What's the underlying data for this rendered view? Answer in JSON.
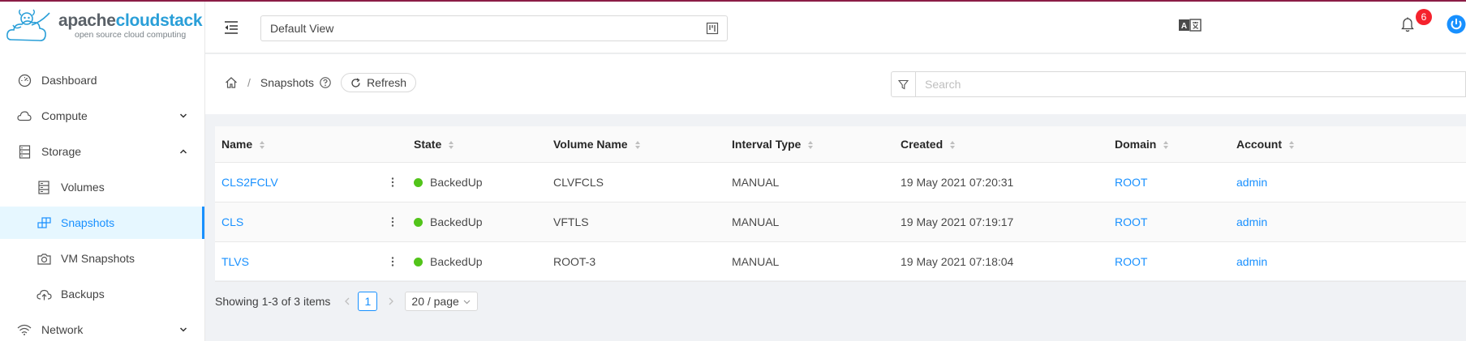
{
  "app": {
    "logo_main_a": "apache",
    "logo_main_b": "cloudstack",
    "logo_sub": "open source cloud computing"
  },
  "header": {
    "project_view": "Default View",
    "notification_count": "6"
  },
  "sidebar": {
    "items": [
      {
        "label": "Dashboard",
        "icon": "dashboard-icon"
      },
      {
        "label": "Compute",
        "icon": "cloud-icon"
      },
      {
        "label": "Storage",
        "icon": "database-icon"
      },
      {
        "label": "Volumes",
        "icon": "hdd-icon"
      },
      {
        "label": "Snapshots",
        "icon": "build-icon"
      },
      {
        "label": "VM Snapshots",
        "icon": "camera-icon"
      },
      {
        "label": "Backups",
        "icon": "cloud-upload-icon"
      },
      {
        "label": "Network",
        "icon": "wifi-icon"
      }
    ]
  },
  "breadcrumb": {
    "current": "Snapshots",
    "refresh_label": "Refresh"
  },
  "search": {
    "placeholder": "Search"
  },
  "table": {
    "columns": [
      "Name",
      "State",
      "Volume Name",
      "Interval Type",
      "Created",
      "Domain",
      "Account"
    ],
    "rows": [
      {
        "name": "CLS2FCLV",
        "state": "BackedUp",
        "volume": "CLVFCLS",
        "interval": "MANUAL",
        "created": "19 May 2021 07:20:31",
        "domain": "ROOT",
        "account": "admin"
      },
      {
        "name": "CLS",
        "state": "BackedUp",
        "volume": "VFTLS",
        "interval": "MANUAL",
        "created": "19 May 2021 07:19:17",
        "domain": "ROOT",
        "account": "admin"
      },
      {
        "name": "TLVS",
        "state": "BackedUp",
        "volume": "ROOT-3",
        "interval": "MANUAL",
        "created": "19 May 2021 07:18:04",
        "domain": "ROOT",
        "account": "admin"
      }
    ]
  },
  "pagination": {
    "summary": "Showing 1-3 of 3 items",
    "current_page": "1",
    "page_size": "20 / page"
  },
  "colors": {
    "accent": "#1890ff",
    "top_bar": "#8b1c45",
    "success": "#52c41a",
    "badge": "#f5222d"
  }
}
